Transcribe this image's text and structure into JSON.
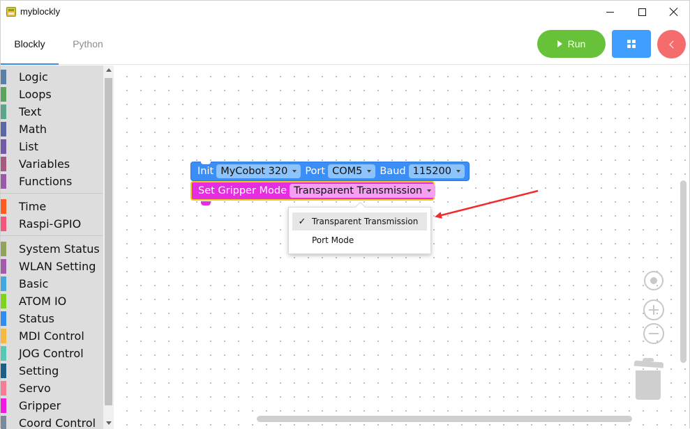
{
  "window": {
    "title": "myblockly"
  },
  "tabs": [
    {
      "label": "Blockly",
      "active": true
    },
    {
      "label": "Python",
      "active": false
    }
  ],
  "toolbar": {
    "run_label": "Run",
    "run_color": "#67c23a",
    "layout_button_color": "#409eff",
    "back_button_color": "#f56c6c"
  },
  "toolbox": {
    "categories": [
      {
        "label": "Logic",
        "color": "#5b80a5"
      },
      {
        "label": "Loops",
        "color": "#5ba55b"
      },
      {
        "label": "Text",
        "color": "#5ba58c"
      },
      {
        "label": "Math",
        "color": "#5b67a5"
      },
      {
        "label": "List",
        "color": "#745ba5"
      },
      {
        "label": "Variables",
        "color": "#a55b80"
      },
      {
        "label": "Functions",
        "color": "#995ba5"
      },
      {
        "label": "Time",
        "color": "#ff5a1f"
      },
      {
        "label": "Raspi-GPIO",
        "color": "#f4567a"
      },
      {
        "label": "System Status",
        "color": "#8fa35b"
      },
      {
        "label": "WLAN Setting",
        "color": "#a55bab"
      },
      {
        "label": "Basic",
        "color": "#41a8e0"
      },
      {
        "label": "ATOM IO",
        "color": "#7ed321"
      },
      {
        "label": "Status",
        "color": "#2e8df0"
      },
      {
        "label": "MDI Control",
        "color": "#f5b93f"
      },
      {
        "label": "JOG Control",
        "color": "#55c9b5"
      },
      {
        "label": "Setting",
        "color": "#1d5e82"
      },
      {
        "label": "Servo",
        "color": "#f37e93"
      },
      {
        "label": "Gripper",
        "color": "#f01be0"
      },
      {
        "label": "Coord Control",
        "color": "#7a8a9a"
      }
    ]
  },
  "blocks": {
    "init": {
      "label": "Init",
      "robot_value": "MyCobot 320",
      "port_label": "Port",
      "port_value": "COM5",
      "baud_label": "Baud",
      "baud_value": "115200",
      "color": "#3a8ef6"
    },
    "gripper": {
      "label": "Set Gripper Mode",
      "mode_value": "Transparent Transmission",
      "color": "#e52ee0"
    }
  },
  "dropdown": {
    "check_mark": "✓",
    "options": [
      {
        "label": "Transparent Transmission",
        "selected": true
      },
      {
        "label": "Port Mode",
        "selected": false
      }
    ]
  },
  "annotation": {
    "arrow_color": "#f22a2a"
  }
}
